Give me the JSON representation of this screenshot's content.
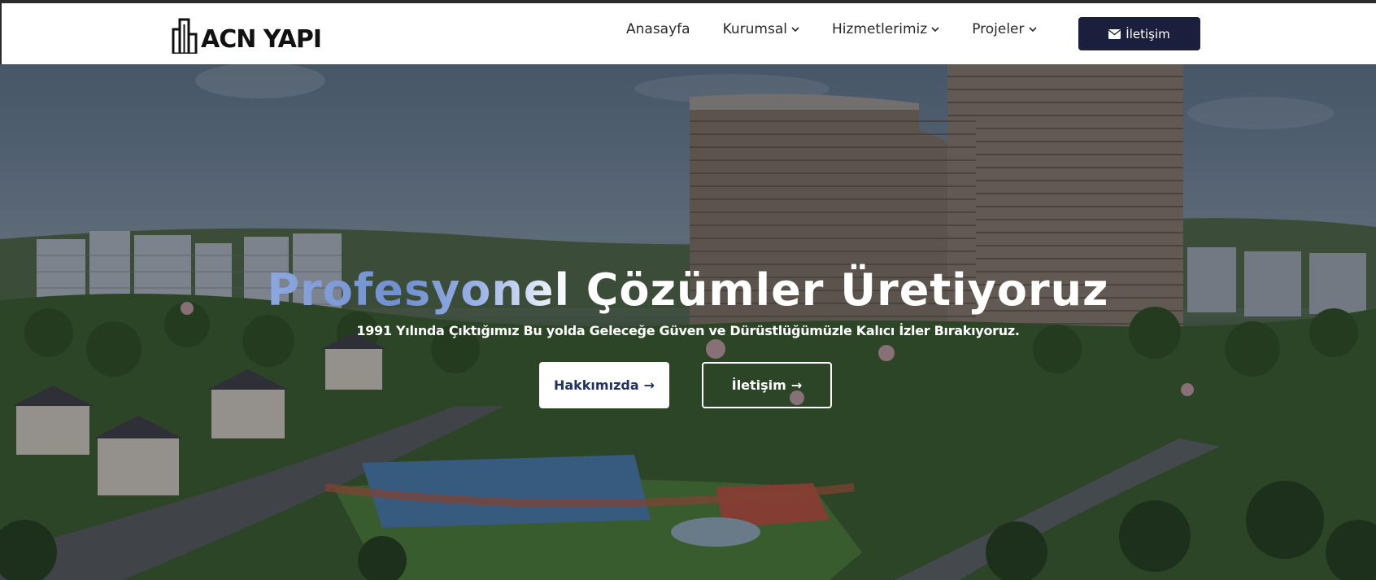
{
  "brand": {
    "name": "ACN YAPI",
    "logo_icon": "building-logo-icon"
  },
  "nav": {
    "items": [
      {
        "label": "Anasayfa",
        "has_dropdown": false
      },
      {
        "label": "Kurumsal",
        "has_dropdown": true
      },
      {
        "label": "Hizmetlerimiz",
        "has_dropdown": true
      },
      {
        "label": "Projeler",
        "has_dropdown": true
      }
    ],
    "contact_label": "İletişim",
    "contact_icon": "envelope-icon"
  },
  "hero": {
    "title_accent": "Profesyonel",
    "title_rest": " Çözümler Üretiyoruz",
    "subtitle": "1991 Yılında Çıktığımız Bu yolda Geleceğe Güven ve Dürüstlüğümüzle  Kalıcı İzler Bırakıyoruz.",
    "primary_button": "Hakkımızda",
    "secondary_button": "İletişim",
    "button_arrow": "→"
  },
  "colors": {
    "primary_dark": "#1b1e3c",
    "accent_blue": "#6f8fd0",
    "button_text": "#1f3260"
  }
}
